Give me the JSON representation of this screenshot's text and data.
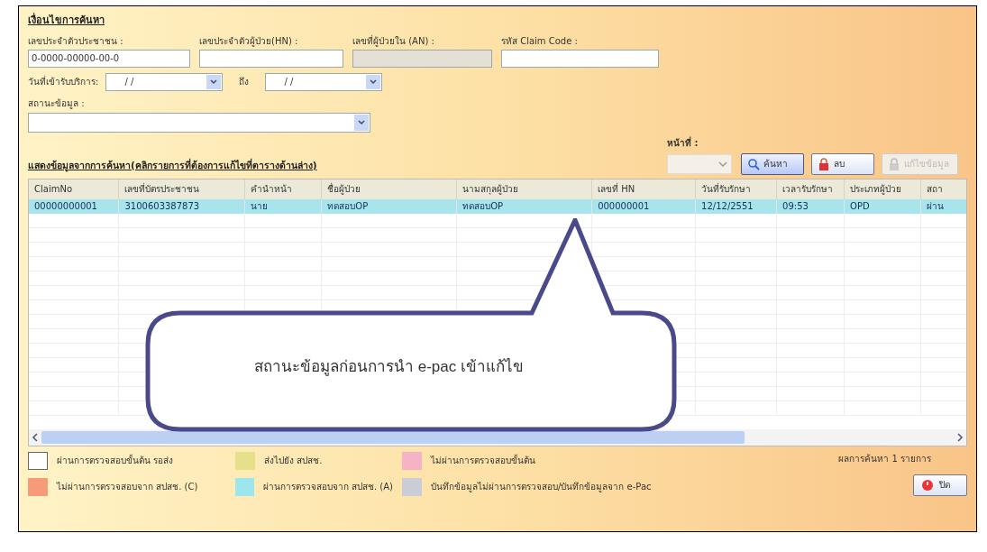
{
  "search_panel": {
    "title": "เงื่อนไขการค้นหา",
    "fields": [
      {
        "label": "เลขประจำตัวประชาชน :",
        "value": "0-0000-00000-00-0",
        "disabled": false
      },
      {
        "label": "เลขประจำตัวผู้ป่วย(HN) :",
        "disabled": false
      },
      {
        "label": "เลขที่ผู้ป่วยใน (AN) :",
        "disabled": true
      },
      {
        "label": "รหัส Claim Code :",
        "disabled": false
      }
    ],
    "date_label": "วันที่เข้ารับบริการ:",
    "date_from": "/ /",
    "date_to_label": "ถึง",
    "date_to": "/ /",
    "status_label": "สถานะข้อมูล :"
  },
  "page_label": "หน้าที่ :",
  "buttons": [
    {
      "label": "ค้นหา",
      "kind": "search",
      "disabled": false
    },
    {
      "label": "ลบ",
      "kind": "delete",
      "disabled": false
    },
    {
      "label": "แก้ไขข้อมูล",
      "kind": "edit",
      "disabled": true
    }
  ],
  "results_title": "แสดงข้อมูลจากการค้นหา(คลิกรายการที่ต้องการแก้ไขที่ตารางด้านล่าง)",
  "table": {
    "columns": [
      "ClaimNo",
      "เลขที่บัตรประชาชน",
      "คำนำหน้า",
      "ชื่อผู้ป่วย",
      "นามสกุลผู้ป่วย",
      "เลขที่ HN",
      "วันที่รับรักษา",
      "เวลารับรักษา",
      "ประเภทผู้ป่วย",
      "สถา"
    ],
    "rows": [
      {
        "selected": true,
        "cells": [
          "00000000001",
          "3100603387873",
          "นาย",
          "ทดสอบOP",
          "ทดสอบOP",
          "000000001",
          "12/12/2551",
          "09:53",
          "OPD",
          "ผ่าน"
        ]
      }
    ]
  },
  "callout": "สถานะข้อมูลก่อนการนำ e-pac เข้าแก้ไข",
  "legend": [
    {
      "label": "ผ่านการตรวจสอบขั้นต้น รอส่ง",
      "color": "#ffffff"
    },
    {
      "label": "ส่งไปยัง สปสช.",
      "color": "#e6e08c"
    },
    {
      "label": "ไม่ผ่านการตรวจสอบขั้นต้น",
      "color": "#f7b3c6"
    },
    {
      "label": "ไม่ผ่านการตรวจสอบจาก สปสช. (C)",
      "color": "#f79a78"
    },
    {
      "label": "ผ่านการตรวจสอบจาก สปสช. (A)",
      "color": "#9ee6ee"
    },
    {
      "label": "บันทึกข้อมูลไม่ผ่านการตรวจสอบ/บันทึกข้อมูลจาก e-Pac",
      "color": "#c8cdd6"
    }
  ],
  "result_count": "ผลการค้นหา 1 รายการ",
  "close_button": "ปิด"
}
